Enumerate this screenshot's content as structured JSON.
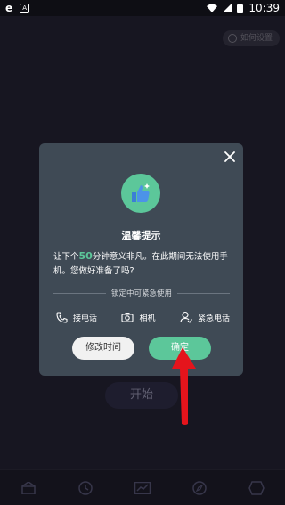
{
  "status_bar": {
    "time": "10:39",
    "left_icons": [
      "browser-e-icon",
      "a-notification-icon"
    ],
    "right_icons": [
      "wifi-icon",
      "signal-icon",
      "battery-icon"
    ]
  },
  "background_app": {
    "top_chip_label": "如何设置",
    "start_label": "开始",
    "nav": [
      "home-icon",
      "clock-icon",
      "chart-icon",
      "compass-icon",
      "hexagon-icon"
    ]
  },
  "dialog": {
    "title": "温馨提示",
    "message_prefix": "让下个",
    "message_highlight": "50",
    "message_suffix": "分钟意义非凡。在此期间无法使用手机。您做好准备了吗?",
    "divider_label": "锁定中可紧急使用",
    "emergency": [
      {
        "icon": "phone-icon",
        "label": "接电话"
      },
      {
        "icon": "camera-icon",
        "label": "相机"
      },
      {
        "icon": "emergency-contact-icon",
        "label": "紧急电话"
      }
    ],
    "modify_label": "修改时间",
    "confirm_label": "确定"
  },
  "colors": {
    "accent": "#5cc79a",
    "dialog_bg": "#3f4a55",
    "annotation_arrow": "#e5141c"
  }
}
